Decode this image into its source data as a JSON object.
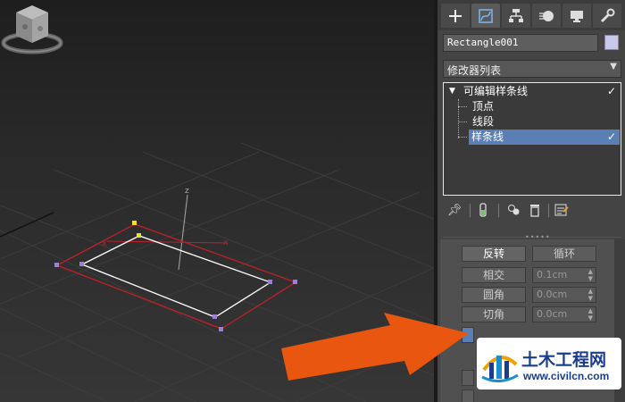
{
  "viewport": {
    "axis_x_label": "x",
    "axis_y_label": "x",
    "axis_z_label": "z"
  },
  "command_panel": {
    "tabs": [
      {
        "icon": "plus-icon",
        "active": false
      },
      {
        "icon": "modify-icon",
        "active": true
      },
      {
        "icon": "hierarchy-icon",
        "active": false
      },
      {
        "icon": "motion-icon",
        "active": false
      },
      {
        "icon": "display-icon",
        "active": false
      },
      {
        "icon": "utilities-icon",
        "active": false
      }
    ],
    "object_name": "Rectangle001",
    "object_color": "#c8c8ee",
    "modifier_list": "修改器列表",
    "stack": {
      "root": "可编辑样条线",
      "sub_objects": [
        "顶点",
        "线段",
        "样条线"
      ],
      "selected": "样条线"
    },
    "geometry": {
      "reverse_label": "反转",
      "loop_label": "循环",
      "intersect_label": "相交",
      "intersect_value": "0.1cm",
      "fillet_label": "圆角",
      "fillet_value": "0.0cm",
      "chamfer_label": "切角",
      "chamfer_value": "0.0cm"
    }
  },
  "watermark": {
    "title": "土木工程网",
    "url": "www.civilcn.com"
  },
  "colors": {
    "selection_red": "#c0202a",
    "spline_white": "#ffffff",
    "vertex_purple": "#9a80d8",
    "vertex_yellow": "#f0e020",
    "highlight_blue": "#5a7fb5",
    "arrow_orange": "#e8560f"
  }
}
